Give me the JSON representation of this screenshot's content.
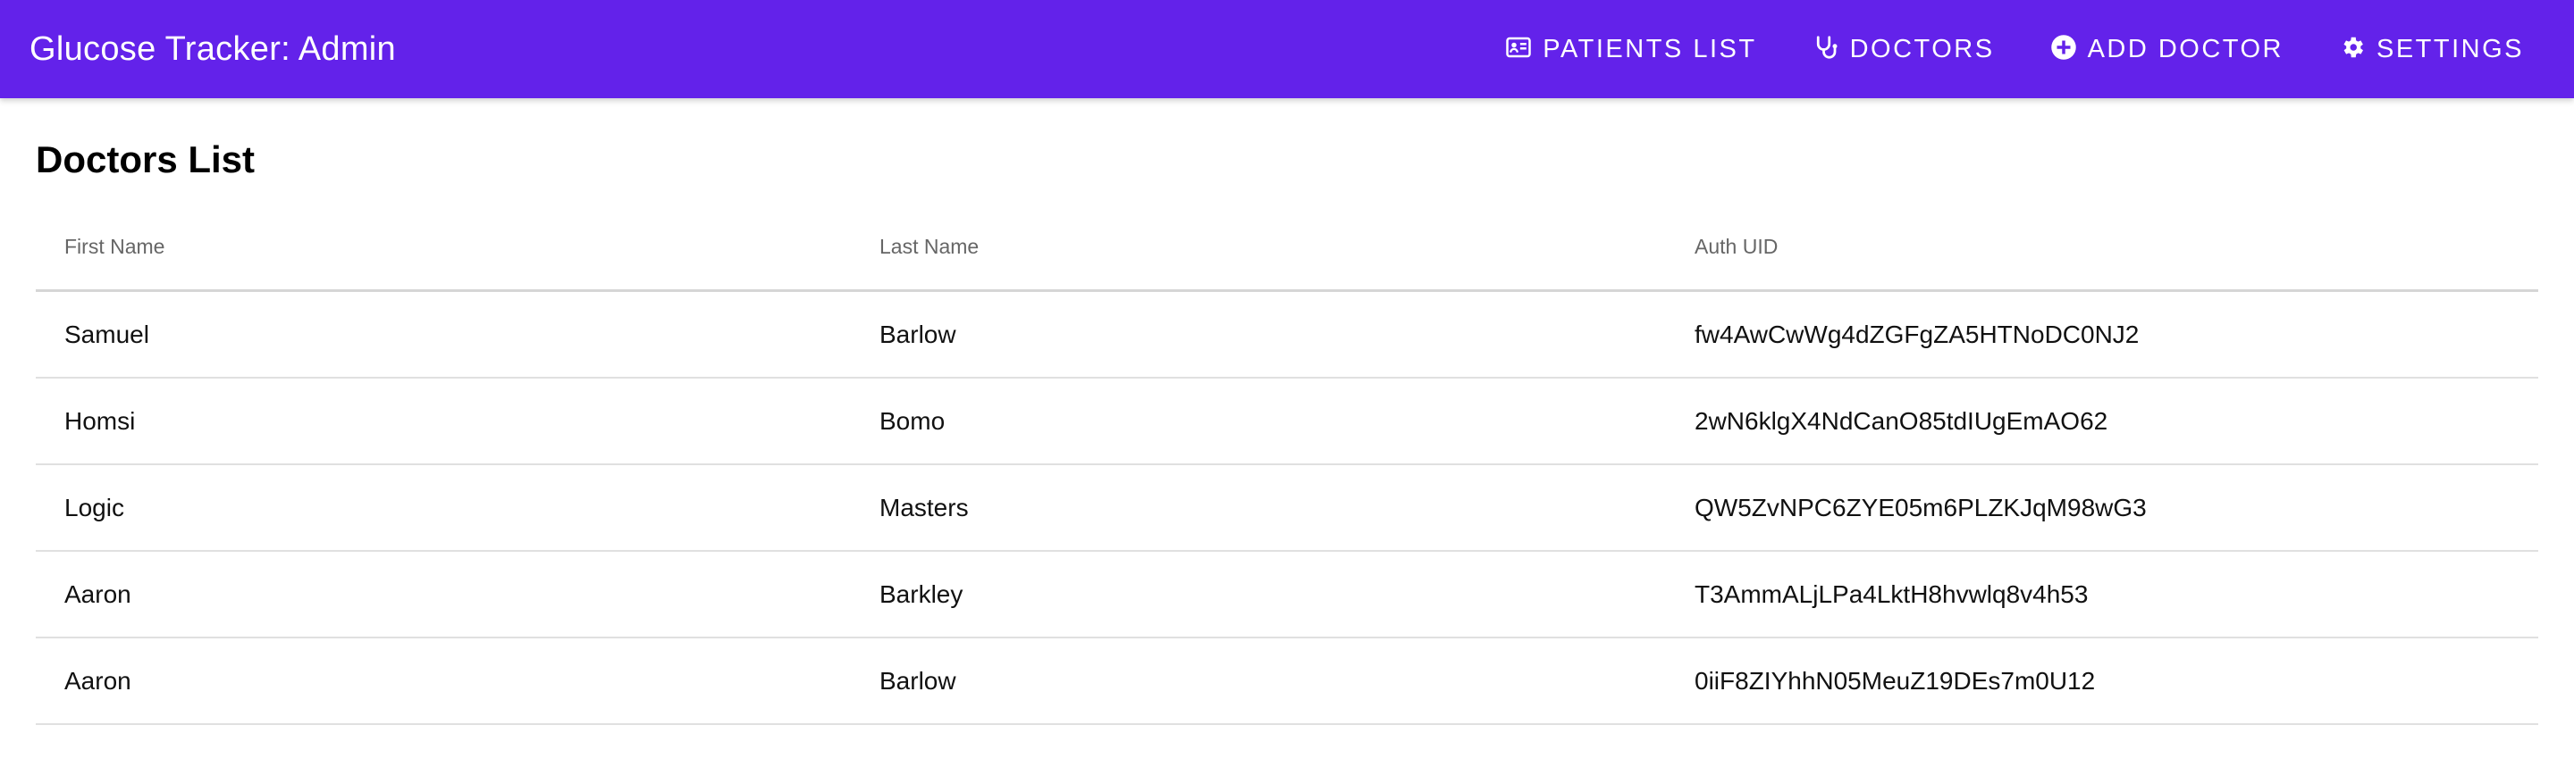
{
  "app": {
    "title": "Glucose Tracker: Admin"
  },
  "nav": {
    "items": [
      {
        "label": "PATIENTS LIST",
        "icon": "id-card-icon"
      },
      {
        "label": "DOCTORS",
        "icon": "stethoscope-icon"
      },
      {
        "label": "ADD DOCTOR",
        "icon": "plus-circle-icon"
      },
      {
        "label": "SETTINGS",
        "icon": "gear-icon"
      }
    ]
  },
  "colors": {
    "appbar": "#6322ea",
    "header_text": "#666666",
    "divider": "#e0e0e0"
  },
  "main": {
    "title": "Doctors List",
    "table": {
      "columns": [
        "First Name",
        "Last Name",
        "Auth UID"
      ],
      "rows": [
        [
          "Samuel",
          "Barlow",
          "fw4AwCwWg4dZGFgZA5HTNoDC0NJ2"
        ],
        [
          "Homsi",
          "Bomo",
          "2wN6klgX4NdCanO85tdIUgEmAO62"
        ],
        [
          "Logic",
          "Masters",
          "QW5ZvNPC6ZYE05m6PLZKJqM98wG3"
        ],
        [
          "Aaron",
          "Barkley",
          "T3AmmALjLPa4LktH8hvwlq8v4h53"
        ],
        [
          "Aaron",
          "Barlow",
          "0iiF8ZIYhhN05MeuZ19DEs7m0U12"
        ]
      ]
    }
  }
}
